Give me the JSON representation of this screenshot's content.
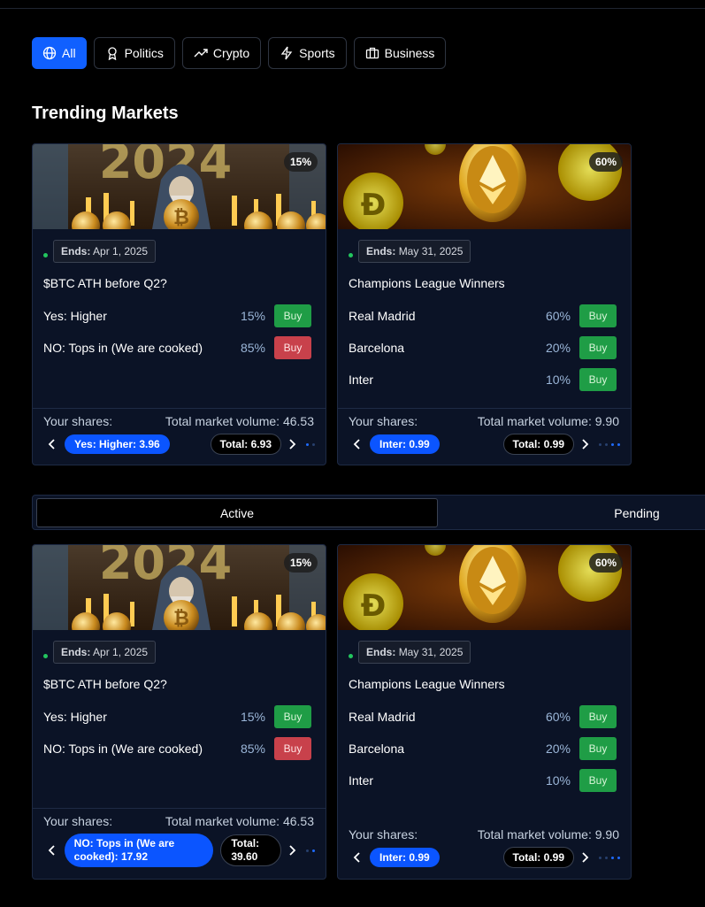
{
  "filters": [
    {
      "label": "All",
      "icon": "globe-icon",
      "active": true
    },
    {
      "label": "Politics",
      "icon": "award-icon"
    },
    {
      "label": "Crypto",
      "icon": "trending-up-icon"
    },
    {
      "label": "Sports",
      "icon": "lightning-icon"
    },
    {
      "label": "Business",
      "icon": "briefcase-icon"
    }
  ],
  "section_title": "Trending Markets",
  "tabs": {
    "active": "Active",
    "pending": "Pending"
  },
  "cards": [
    {
      "badge": "15%",
      "ends_label": "Ends:",
      "ends_date": "Apr 1, 2025",
      "question": "$BTC ATH before Q2?",
      "outcomes": [
        {
          "name": "Yes: Higher",
          "pct": "15%",
          "buy": "Buy",
          "color": "green"
        },
        {
          "name": "NO: Tops in (We are cooked)",
          "pct": "85%",
          "buy": "Buy",
          "color": "red"
        }
      ],
      "shares_label": "Your shares:",
      "volume_label": "Total market volume: 46.53",
      "share_pill": "Yes: Higher: 3.96",
      "total_pill": "Total: 6.93"
    },
    {
      "badge": "60%",
      "ends_label": "Ends:",
      "ends_date": "May 31, 2025",
      "question": "Champions League Winners",
      "outcomes": [
        {
          "name": "Real Madrid",
          "pct": "60%",
          "buy": "Buy",
          "color": "green"
        },
        {
          "name": "Barcelona",
          "pct": "20%",
          "buy": "Buy",
          "color": "green"
        },
        {
          "name": "Inter",
          "pct": "10%",
          "buy": "Buy",
          "color": "green"
        }
      ],
      "shares_label": "Your shares:",
      "volume_label": "Total market volume: 9.90",
      "share_pill": "Inter: 0.99",
      "total_pill": "Total: 0.99"
    },
    {
      "badge": "15%",
      "ends_label": "Ends:",
      "ends_date": "Apr 1, 2025",
      "question": "$BTC ATH before Q2?",
      "outcomes": [
        {
          "name": "Yes: Higher",
          "pct": "15%",
          "buy": "Buy",
          "color": "green"
        },
        {
          "name": "NO: Tops in (We are cooked)",
          "pct": "85%",
          "buy": "Buy",
          "color": "red"
        }
      ],
      "shares_label": "Your shares:",
      "volume_label": "Total market volume: 46.53",
      "share_pill": "NO: Tops in (We are cooked): 17.92",
      "total_pill": "Total: 39.60"
    },
    {
      "badge": "60%",
      "ends_label": "Ends:",
      "ends_date": "May 31, 2025",
      "question": "Champions League Winners",
      "outcomes": [
        {
          "name": "Real Madrid",
          "pct": "60%",
          "buy": "Buy",
          "color": "green"
        },
        {
          "name": "Barcelona",
          "pct": "20%",
          "buy": "Buy",
          "color": "green"
        },
        {
          "name": "Inter",
          "pct": "10%",
          "buy": "Buy",
          "color": "green"
        }
      ],
      "shares_label": "Your shares:",
      "volume_label": "Total market volume: 9.90",
      "share_pill": "Inter: 0.99",
      "total_pill": "Total: 0.99"
    }
  ],
  "colors": {
    "accent": "#1060ff",
    "buy_green": "#1f9d46",
    "buy_red": "#c8414b",
    "card_bg": "#0b1326"
  }
}
